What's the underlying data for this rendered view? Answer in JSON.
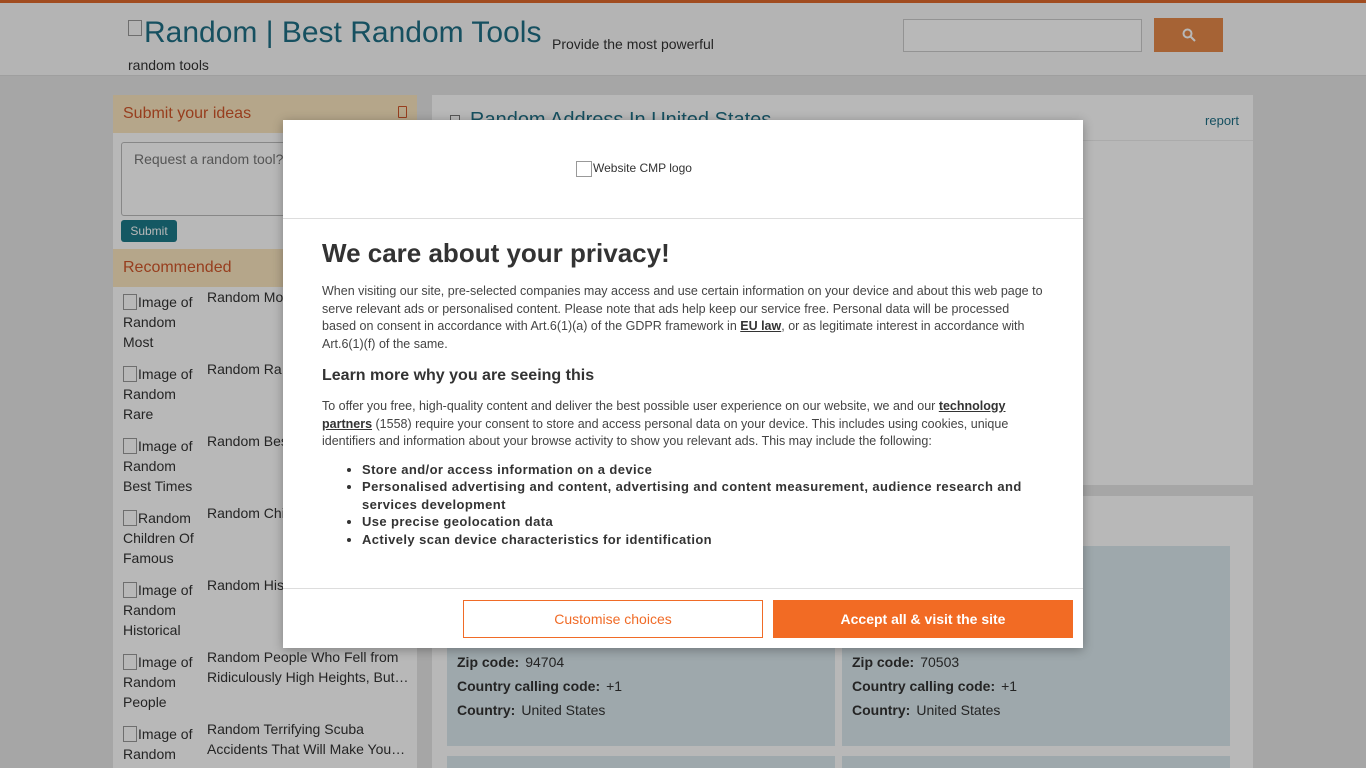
{
  "header": {
    "logo_alt": "Random | Best Random Tools",
    "tagline_part1": "Provide the most powerful",
    "tagline_part2": "random tools",
    "search_value": ""
  },
  "sidebar": {
    "ideas_heading": "Submit your ideas",
    "ideas_placeholder": "Request a random tool?",
    "submit_label": "Submit",
    "recommended_heading": "Recommended",
    "items": [
      {
        "thumb_alt": "Image of Random Most",
        "title": "Random Mo… We Learned"
      },
      {
        "thumb_alt": "Image of Random Rare",
        "title": "Random Ra… World War II"
      },
      {
        "thumb_alt": "Image of Random Best Times",
        "title": "Random Bes… Women Call"
      },
      {
        "thumb_alt": "Random Children Of Famous",
        "title": "Random Chi… Cult Leaders"
      },
      {
        "thumb_alt": "Image of Random Historical",
        "title": "Random His… Methods De"
      },
      {
        "thumb_alt": "Image of Random People",
        "title": "Random People Who Fell from Ridiculously High Heights, But…"
      },
      {
        "thumb_alt": "Image of Random",
        "title": "Random Terrifying Scuba Accidents That Will Make You…"
      }
    ]
  },
  "main": {
    "title": "Random Address In United States",
    "report_label": "report"
  },
  "address_cards": [
    {
      "zip_label": "Zip code:",
      "zip": "94704",
      "calling_label": "Country calling code:",
      "calling": "+1",
      "country_label": "Country:",
      "country": "United States"
    },
    {
      "zip_label": "Zip code:",
      "zip": "70503",
      "calling_label": "Country calling code:",
      "calling": "+1",
      "country_label": "Country:",
      "country": "United States"
    }
  ],
  "consent": {
    "logo_alt": "Website CMP logo",
    "heading": "We care about your privacy!",
    "intro_pre": "When visiting our site, pre-selected companies may access and use certain information on your device and about this web page to serve relevant ads or personalised content. Please note that ads help keep our service free. Personal data will be processed based on consent in accordance with Art.6(1)(a) of the GDPR framework in ",
    "intro_link": "EU law",
    "intro_post": ", or as legitimate interest in accordance with Art.6(1)(f) of the same.",
    "subheading": "Learn more why you are seeing this",
    "body_pre": "To offer you free, high-quality content and deliver the best possible user experience on our website, we and our ",
    "body_link": "technology partners",
    "body_post": " (1558) require your consent to store and access personal data on your device. This includes using cookies, unique identifiers and information about your browse activity to show you relevant ads. This may include the following:",
    "purposes": [
      "Store and/or access information on a device",
      "Personalised advertising and content, advertising and content measurement, audience research and services development",
      "Use precise geolocation data",
      "Actively scan device characteristics for identification"
    ],
    "customise_label": "Customise choices",
    "accept_label": "Accept all & visit the site"
  }
}
